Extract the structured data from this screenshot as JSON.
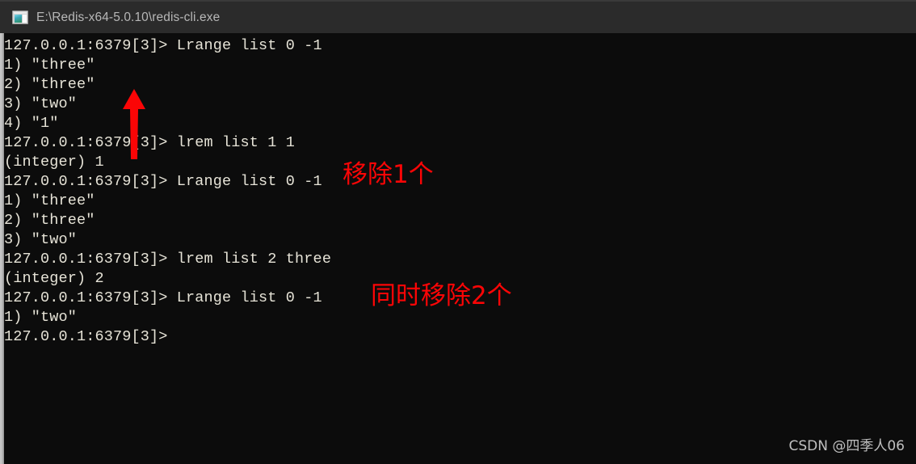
{
  "window": {
    "title": "E:\\Redis-x64-5.0.10\\redis-cli.exe",
    "icon": "console-window-icon",
    "titlebar_color": "#2b2b2b",
    "terminal_bg_color": "#0c0c0c",
    "terminal_fg_color": "#e6e3d7"
  },
  "terminal": {
    "prompt": "127.0.0.1:6379[3]>",
    "lines": [
      "127.0.0.1:6379[3]> Lrange list 0 -1",
      "1) \"three\"",
      "2) \"three\"",
      "3) \"two\"",
      "4) \"1\"",
      "127.0.0.1:6379[3]> lrem list 1 1",
      "(integer) 1",
      "127.0.0.1:6379[3]> Lrange list 0 -1",
      "1) \"three\"",
      "2) \"three\"",
      "3) \"two\"",
      "127.0.0.1:6379[3]> lrem list 2 three",
      "(integer) 2",
      "127.0.0.1:6379[3]> Lrange list 0 -1",
      "1) \"two\"",
      "127.0.0.1:6379[3]>"
    ]
  },
  "annotations": {
    "color": "#fb0506",
    "arrow": {
      "name": "red-up-arrow",
      "direction": "up"
    },
    "notes": [
      {
        "text": "移除1个"
      },
      {
        "text": "同时移除2个"
      }
    ]
  },
  "watermark": {
    "text": "CSDN @四季人06"
  }
}
